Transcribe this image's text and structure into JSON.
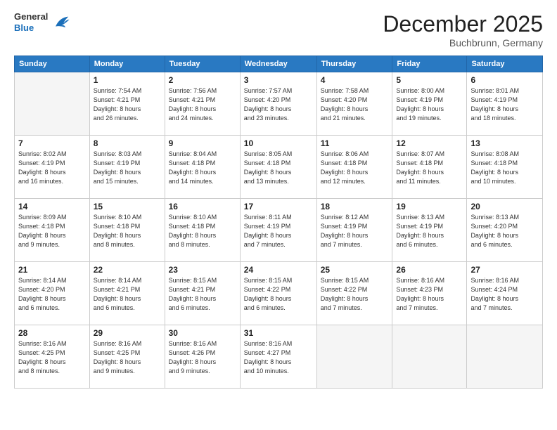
{
  "header": {
    "logo": {
      "general": "General",
      "blue": "Blue"
    },
    "title": "December 2025",
    "location": "Buchbrunn, Germany"
  },
  "weekdays": [
    "Sunday",
    "Monday",
    "Tuesday",
    "Wednesday",
    "Thursday",
    "Friday",
    "Saturday"
  ],
  "weeks": [
    [
      {
        "day": "",
        "info": ""
      },
      {
        "day": "1",
        "info": "Sunrise: 7:54 AM\nSunset: 4:21 PM\nDaylight: 8 hours\nand 26 minutes."
      },
      {
        "day": "2",
        "info": "Sunrise: 7:56 AM\nSunset: 4:21 PM\nDaylight: 8 hours\nand 24 minutes."
      },
      {
        "day": "3",
        "info": "Sunrise: 7:57 AM\nSunset: 4:20 PM\nDaylight: 8 hours\nand 23 minutes."
      },
      {
        "day": "4",
        "info": "Sunrise: 7:58 AM\nSunset: 4:20 PM\nDaylight: 8 hours\nand 21 minutes."
      },
      {
        "day": "5",
        "info": "Sunrise: 8:00 AM\nSunset: 4:19 PM\nDaylight: 8 hours\nand 19 minutes."
      },
      {
        "day": "6",
        "info": "Sunrise: 8:01 AM\nSunset: 4:19 PM\nDaylight: 8 hours\nand 18 minutes."
      }
    ],
    [
      {
        "day": "7",
        "info": "Sunrise: 8:02 AM\nSunset: 4:19 PM\nDaylight: 8 hours\nand 16 minutes."
      },
      {
        "day": "8",
        "info": "Sunrise: 8:03 AM\nSunset: 4:19 PM\nDaylight: 8 hours\nand 15 minutes."
      },
      {
        "day": "9",
        "info": "Sunrise: 8:04 AM\nSunset: 4:18 PM\nDaylight: 8 hours\nand 14 minutes."
      },
      {
        "day": "10",
        "info": "Sunrise: 8:05 AM\nSunset: 4:18 PM\nDaylight: 8 hours\nand 13 minutes."
      },
      {
        "day": "11",
        "info": "Sunrise: 8:06 AM\nSunset: 4:18 PM\nDaylight: 8 hours\nand 12 minutes."
      },
      {
        "day": "12",
        "info": "Sunrise: 8:07 AM\nSunset: 4:18 PM\nDaylight: 8 hours\nand 11 minutes."
      },
      {
        "day": "13",
        "info": "Sunrise: 8:08 AM\nSunset: 4:18 PM\nDaylight: 8 hours\nand 10 minutes."
      }
    ],
    [
      {
        "day": "14",
        "info": "Sunrise: 8:09 AM\nSunset: 4:18 PM\nDaylight: 8 hours\nand 9 minutes."
      },
      {
        "day": "15",
        "info": "Sunrise: 8:10 AM\nSunset: 4:18 PM\nDaylight: 8 hours\nand 8 minutes."
      },
      {
        "day": "16",
        "info": "Sunrise: 8:10 AM\nSunset: 4:18 PM\nDaylight: 8 hours\nand 8 minutes."
      },
      {
        "day": "17",
        "info": "Sunrise: 8:11 AM\nSunset: 4:19 PM\nDaylight: 8 hours\nand 7 minutes."
      },
      {
        "day": "18",
        "info": "Sunrise: 8:12 AM\nSunset: 4:19 PM\nDaylight: 8 hours\nand 7 minutes."
      },
      {
        "day": "19",
        "info": "Sunrise: 8:13 AM\nSunset: 4:19 PM\nDaylight: 8 hours\nand 6 minutes."
      },
      {
        "day": "20",
        "info": "Sunrise: 8:13 AM\nSunset: 4:20 PM\nDaylight: 8 hours\nand 6 minutes."
      }
    ],
    [
      {
        "day": "21",
        "info": "Sunrise: 8:14 AM\nSunset: 4:20 PM\nDaylight: 8 hours\nand 6 minutes."
      },
      {
        "day": "22",
        "info": "Sunrise: 8:14 AM\nSunset: 4:21 PM\nDaylight: 8 hours\nand 6 minutes."
      },
      {
        "day": "23",
        "info": "Sunrise: 8:15 AM\nSunset: 4:21 PM\nDaylight: 8 hours\nand 6 minutes."
      },
      {
        "day": "24",
        "info": "Sunrise: 8:15 AM\nSunset: 4:22 PM\nDaylight: 8 hours\nand 6 minutes."
      },
      {
        "day": "25",
        "info": "Sunrise: 8:15 AM\nSunset: 4:22 PM\nDaylight: 8 hours\nand 7 minutes."
      },
      {
        "day": "26",
        "info": "Sunrise: 8:16 AM\nSunset: 4:23 PM\nDaylight: 8 hours\nand 7 minutes."
      },
      {
        "day": "27",
        "info": "Sunrise: 8:16 AM\nSunset: 4:24 PM\nDaylight: 8 hours\nand 7 minutes."
      }
    ],
    [
      {
        "day": "28",
        "info": "Sunrise: 8:16 AM\nSunset: 4:25 PM\nDaylight: 8 hours\nand 8 minutes."
      },
      {
        "day": "29",
        "info": "Sunrise: 8:16 AM\nSunset: 4:25 PM\nDaylight: 8 hours\nand 9 minutes."
      },
      {
        "day": "30",
        "info": "Sunrise: 8:16 AM\nSunset: 4:26 PM\nDaylight: 8 hours\nand 9 minutes."
      },
      {
        "day": "31",
        "info": "Sunrise: 8:16 AM\nSunset: 4:27 PM\nDaylight: 8 hours\nand 10 minutes."
      },
      {
        "day": "",
        "info": ""
      },
      {
        "day": "",
        "info": ""
      },
      {
        "day": "",
        "info": ""
      }
    ]
  ]
}
